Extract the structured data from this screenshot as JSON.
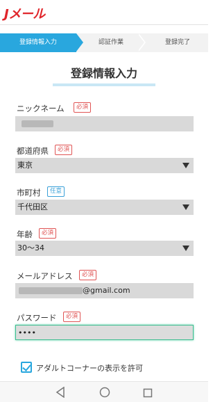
{
  "header": {
    "logo_text": "Jメール"
  },
  "steps": [
    {
      "label": "登録情報入力",
      "active": true
    },
    {
      "label": "認証作業",
      "active": false
    },
    {
      "label": "登録完了",
      "active": false
    }
  ],
  "page_title": "登録情報入力",
  "form": {
    "nickname": {
      "label": "ニックネーム",
      "badge": "必須",
      "value": ""
    },
    "prefecture": {
      "label": "都道府県",
      "badge": "必須",
      "value": "東京"
    },
    "city": {
      "label": "市町村",
      "badge": "任意",
      "value": "千代田区"
    },
    "age": {
      "label": "年齢",
      "badge": "必須",
      "value": "30〜34"
    },
    "email": {
      "label": "メールアドレス",
      "badge": "必須",
      "value_suffix": "@gmail.com"
    },
    "password": {
      "label": "パスワード",
      "badge": "必須",
      "value": "••••"
    }
  },
  "adult_checkbox": {
    "label": "アダルトコーナーの表示を許可",
    "checked": true
  },
  "colors": {
    "accent": "#29a7de",
    "required": "#e05454",
    "optional": "#3aa0d8",
    "brand": "#e0252b"
  },
  "nav_icons": [
    "back-icon",
    "home-icon",
    "recent-apps-icon"
  ]
}
